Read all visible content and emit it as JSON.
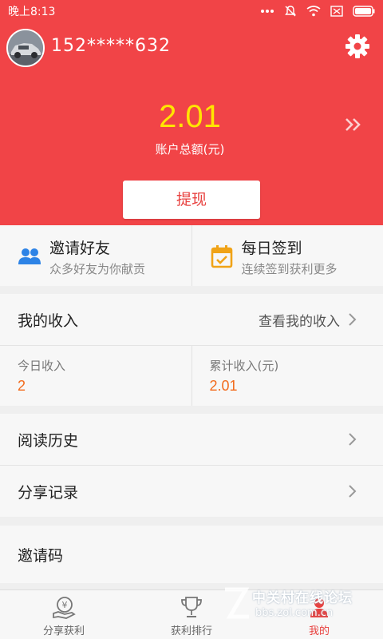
{
  "status_bar": {
    "time": "晚上8:13",
    "icons": [
      "more-dots-icon",
      "mute-icon",
      "wifi-icon",
      "sim-none-icon",
      "battery-icon"
    ]
  },
  "header": {
    "phone": "152*****632",
    "balance": "2.01",
    "balance_label": "账户总额(元)",
    "withdraw_label": "提现",
    "bg_color": "#f14447",
    "balance_color": "#ffe500"
  },
  "quick_actions": [
    {
      "title": "邀请好友",
      "subtitle": "众多好友为你献贡",
      "icon": "people-icon"
    },
    {
      "title": "每日签到",
      "subtitle": "连续签到获利更多",
      "icon": "calendar-check-icon"
    }
  ],
  "income": {
    "label": "我的收入",
    "view_link": "查看我的收入",
    "today_label": "今日收入",
    "today_value": "2",
    "total_label": "累计收入(元)",
    "total_value": "2.01",
    "value_color": "#f26b1d"
  },
  "menu": {
    "history": "阅读历史",
    "share_records": "分享记录",
    "invite_code": "邀请码"
  },
  "tabs": [
    {
      "label": "分享获利",
      "icon": "share-coin-icon"
    },
    {
      "label": "获利排行",
      "icon": "trophy-icon"
    },
    {
      "label": "我的",
      "icon": "user-icon",
      "active": true
    }
  ],
  "watermark": {
    "title": "中关村在线论坛",
    "url": "bbs.zol.com.cn"
  }
}
